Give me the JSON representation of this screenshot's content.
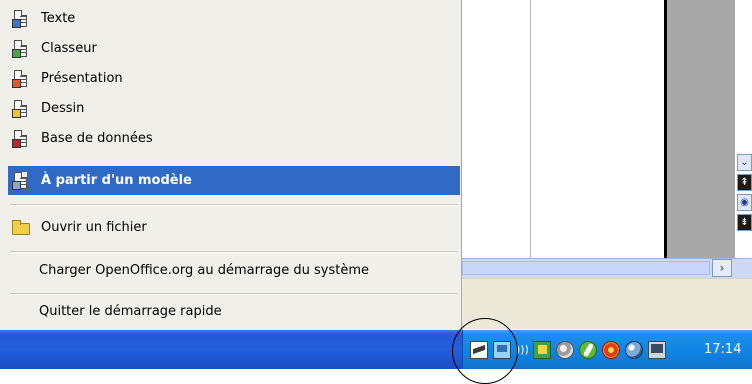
{
  "menu": {
    "items": [
      {
        "label": "Texte",
        "icon": "writer-document-icon"
      },
      {
        "label": "Classeur",
        "icon": "calc-spreadsheet-icon"
      },
      {
        "label": "Présentation",
        "icon": "impress-presentation-icon"
      },
      {
        "label": "Dessin",
        "icon": "draw-drawing-icon"
      },
      {
        "label": "Base de données",
        "icon": "base-database-icon"
      },
      {
        "label": "À partir d'un modèle",
        "icon": "template-document-icon",
        "selected": true
      },
      {
        "label": "Ouvrir un fichier",
        "icon": "open-folder-icon"
      },
      {
        "label": "Charger OpenOffice.org au démarrage du système"
      },
      {
        "label": "Quitter le démarrage rapide"
      }
    ]
  },
  "tray": {
    "icons": [
      "openoffice-quickstart-icon",
      "network-icon",
      "green-app-icon",
      "disc-icon",
      "leaf-icon",
      "ring-icon",
      "globe-icon",
      "monitor-icon"
    ],
    "clock": "17:14"
  },
  "colors": {
    "menu_bg": "#f0efe9",
    "selected_bg": "#316ac5",
    "taskbar_blue": "#245edb",
    "tray_blue": "#0f83e3"
  }
}
